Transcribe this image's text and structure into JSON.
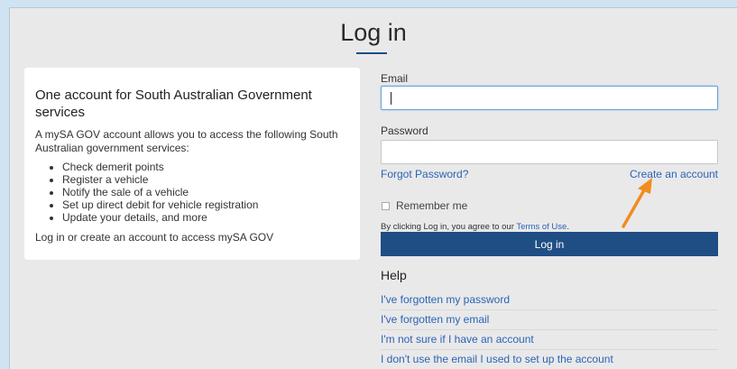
{
  "page": {
    "title": "Log in"
  },
  "info": {
    "heading": "One account for South Australian Government services",
    "intro": "A mySA GOV account allows you to access the following South Australian government services:",
    "services": [
      "Check demerit points",
      "Register a vehicle",
      "Notify the sale of a vehicle",
      "Set up direct debit for vehicle registration",
      "Update your details, and more"
    ],
    "outro": "Log in or create an account to access mySA GOV"
  },
  "form": {
    "email_label": "Email",
    "email_value": "",
    "password_label": "Password",
    "password_value": "",
    "forgot_password": "Forgot Password?",
    "create_account": "Create an account",
    "remember_me": "Remember me",
    "terms_prefix": "By clicking Log in, you agree to our ",
    "terms_link": "Terms of Use",
    "terms_suffix": ".",
    "login_button": "Log in"
  },
  "help": {
    "heading": "Help",
    "items": [
      "I've forgotten my password",
      "I've forgotten my email",
      "I'm not sure if I have an account",
      "I don't use the email I used to set up the account"
    ]
  },
  "colors": {
    "primary": "#1f4e84",
    "link": "#2b64b3",
    "annotation_arrow": "#f28c1e"
  }
}
